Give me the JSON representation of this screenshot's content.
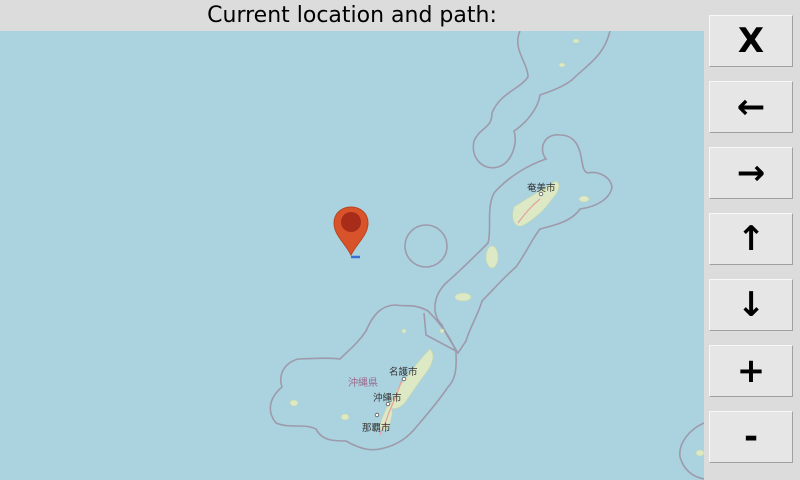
{
  "header": {
    "title": "Current location and path:"
  },
  "map": {
    "places": {
      "amami": "奄美市",
      "nago": "名護市",
      "okinawa_city": "沖縄市",
      "naha": "那覇市",
      "prefecture": "沖縄県"
    },
    "marker_icon": "map-pin-icon",
    "colors": {
      "sea": "#aad3df",
      "land": "#dde9c5",
      "boundary": "#9e9aab",
      "marker": "#d9532a",
      "path": "#3b6fd1"
    }
  },
  "controls": {
    "close": "X",
    "left": "←",
    "right": "→",
    "up": "↑",
    "down": "↓",
    "zoom_in": "+",
    "zoom_out": "-"
  }
}
